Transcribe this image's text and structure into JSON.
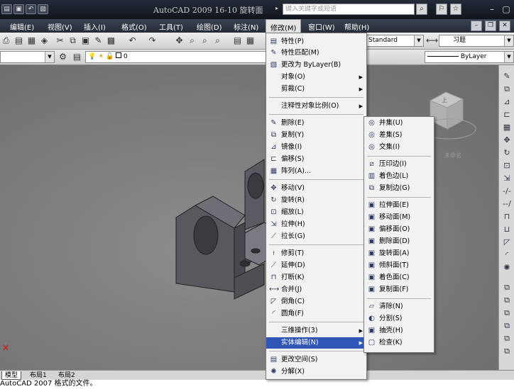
{
  "titlebar": {
    "title": "AutoCAD 2009  16-10 旋转面",
    "search_placeholder": "键入关键字或短语",
    "icons": [
      "new-icon",
      "save-icon",
      "undo-icon",
      "open-icon"
    ],
    "search_buttons": [
      "binoculars-icon",
      "star-group-icon",
      "favorites-icon"
    ]
  },
  "menubar": {
    "items": [
      "编辑(E)",
      "视图(V)",
      "插入(I)",
      "格式(O)",
      "工具(T)",
      "绘图(D)",
      "标注(N)",
      "修改(M)",
      "窗口(W)",
      "帮助(H)"
    ],
    "active": "修改(M)"
  },
  "toolbar1": {
    "textstyle": "Standard",
    "dimstyle": "习题"
  },
  "toolbar2": {
    "layer": "0",
    "lineweight": "ByLayer"
  },
  "modify_menu": [
    {
      "label": "特性(P)",
      "icon": "properties-icon"
    },
    {
      "label": "特性匹配(M)",
      "icon": "match-properties-icon"
    },
    {
      "label": "更改为 ByLayer(B)",
      "icon": "bylayer-icon"
    },
    {
      "label": "对象(O)",
      "sub": true
    },
    {
      "label": "剪裁(C)",
      "sub": true
    },
    {
      "label": "注释性对象比例(O)",
      "sub": true
    },
    {
      "label": "删除(E)",
      "icon": "erase-icon"
    },
    {
      "label": "复制(Y)",
      "icon": "copy-icon"
    },
    {
      "label": "镜像(I)",
      "icon": "mirror-icon"
    },
    {
      "label": "偏移(S)",
      "icon": "offset-icon"
    },
    {
      "label": "阵列(A)...",
      "icon": "array-icon"
    },
    {
      "label": "移动(V)",
      "icon": "move-icon"
    },
    {
      "label": "旋转(R)",
      "icon": "rotate-icon"
    },
    {
      "label": "缩放(L)",
      "icon": "scale-icon"
    },
    {
      "label": "拉伸(H)",
      "icon": "stretch-icon"
    },
    {
      "label": "拉长(G)",
      "icon": "lengthen-icon"
    },
    {
      "label": "修剪(T)",
      "icon": "trim-icon"
    },
    {
      "label": "延伸(D)",
      "icon": "extend-icon"
    },
    {
      "label": "打断(K)",
      "icon": "break-icon"
    },
    {
      "label": "合并(J)",
      "icon": "join-icon"
    },
    {
      "label": "倒角(C)",
      "icon": "chamfer-icon"
    },
    {
      "label": "圆角(F)",
      "icon": "fillet-icon"
    },
    {
      "label": "三维操作(3)",
      "sub": true
    },
    {
      "label": "实体编辑(N)",
      "sub": true,
      "highlight": true
    },
    {
      "label": "更改空间(S)",
      "icon": "change-space-icon"
    },
    {
      "label": "分解(X)",
      "icon": "explode-icon"
    }
  ],
  "solid_edit_menu": [
    {
      "label": "并集(U)",
      "icon": "union-icon"
    },
    {
      "label": "差集(S)",
      "icon": "subtract-icon"
    },
    {
      "label": "交集(I)",
      "icon": "intersect-icon"
    },
    {
      "label": "压印边(I)",
      "icon": "imprint-icon"
    },
    {
      "label": "着色边(L)",
      "icon": "color-edges-icon"
    },
    {
      "label": "复制边(G)",
      "icon": "copy-edges-icon"
    },
    {
      "label": "拉伸面(E)",
      "icon": "extrude-faces-icon"
    },
    {
      "label": "移动面(M)",
      "icon": "move-faces-icon"
    },
    {
      "label": "偏移面(O)",
      "icon": "offset-faces-icon"
    },
    {
      "label": "删除面(D)",
      "icon": "delete-faces-icon"
    },
    {
      "label": "旋转面(A)",
      "icon": "rotate-faces-icon"
    },
    {
      "label": "倾斜面(T)",
      "icon": "taper-faces-icon"
    },
    {
      "label": "着色面(C)",
      "icon": "color-faces-icon"
    },
    {
      "label": "复制面(F)",
      "icon": "copy-faces-icon"
    },
    {
      "label": "清除(N)",
      "icon": "clean-icon"
    },
    {
      "label": "分割(S)",
      "icon": "separate-icon"
    },
    {
      "label": "抽壳(H)",
      "icon": "shell-icon"
    },
    {
      "label": "检查(K)",
      "icon": "check-icon"
    }
  ],
  "viewcube": {
    "face": "上",
    "label": "未命名"
  },
  "tabs": [
    "模型",
    "布局1",
    "布局2"
  ],
  "active_tab": "模型",
  "command_line": "AutoCAD 2007 格式的文件。",
  "colors": {
    "menu_highlight": "#2f55b8",
    "titlebar": "#1a1f28",
    "menubar": "#2e3542",
    "cursor_halo": "#f0e000"
  }
}
